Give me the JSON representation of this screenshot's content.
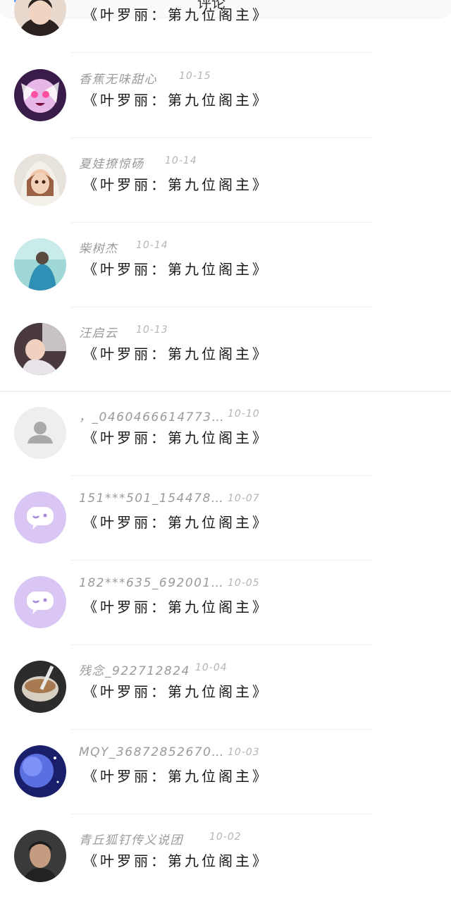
{
  "header": {
    "title": "评论",
    "back_icon": "back-arrow-icon"
  },
  "comments": [
    {
      "name": "",
      "date": "",
      "message": "《叶罗丽：第九位阁主》",
      "avatar": "avatar-girl-icon"
    },
    {
      "name": "香蕉无味甜心",
      "date": "10-15",
      "message": "《叶罗丽：第九位阁主》",
      "avatar": "avatar-anime-icon"
    },
    {
      "name": "夏娃撩惊砀",
      "date": "10-14",
      "message": "《叶罗丽：第九位阁主》",
      "avatar": "avatar-doll-icon"
    },
    {
      "name": "柴树杰",
      "date": "10-14",
      "message": "《叶罗丽：第九位阁主》",
      "avatar": "avatar-photo-icon"
    },
    {
      "name": "汪启云",
      "date": "10-13",
      "message": "《叶罗丽：第九位阁主》",
      "avatar": "avatar-baby-icon"
    },
    {
      "name": "，_0460466614773…",
      "date": "10-10",
      "message": "《叶罗丽：第九位阁主》",
      "avatar": "default-user-icon"
    },
    {
      "name": "151***501_154478…",
      "date": "10-07",
      "message": "《叶罗丽：第九位阁主》",
      "avatar": "chat-bubble-icon"
    },
    {
      "name": "182***635_692001…",
      "date": "10-05",
      "message": "《叶罗丽：第九位阁主》",
      "avatar": "chat-bubble-icon"
    },
    {
      "name": "残念_922712824",
      "date": "10-04",
      "message": "《叶罗丽：第九位阁主》",
      "avatar": "avatar-drink-icon"
    },
    {
      "name": "MQY_36872852670…",
      "date": "10-03",
      "message": "《叶罗丽：第九位阁主》",
      "avatar": "avatar-planet-icon"
    },
    {
      "name": "青丘狐钉传义说团",
      "date": "10-02",
      "message": "《叶罗丽：第九位阁主》",
      "avatar": "avatar-boy-icon"
    }
  ],
  "colors": {
    "accent": "#3d8bff",
    "default_avatar_bg": "#eeeeee",
    "chat_avatar_bg": "#d9c6f5"
  }
}
